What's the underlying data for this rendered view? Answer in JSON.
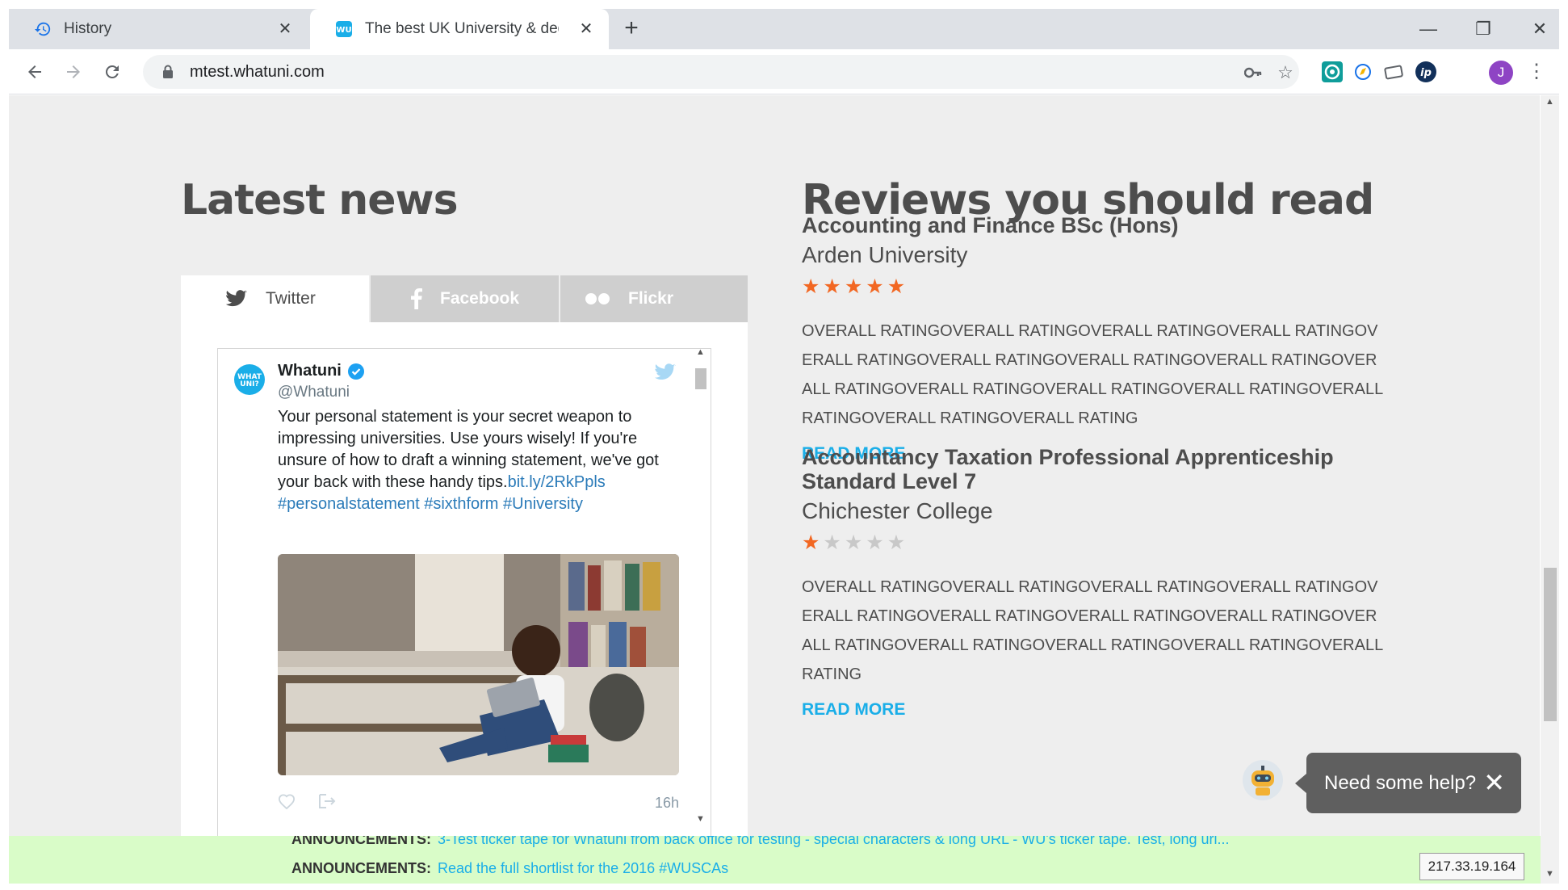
{
  "browser": {
    "tabs": [
      {
        "label": "History",
        "icon": "history-icon",
        "close": "✕"
      },
      {
        "label": "The best UK University & degree",
        "icon": "whatuni-favicon",
        "close": "✕"
      }
    ],
    "new_tab": "+",
    "url": "mtest.whatuni.com",
    "window_controls": {
      "minimize": "—",
      "restore": "❐",
      "close": "✕"
    },
    "profile_initial": "J"
  },
  "latest_news": {
    "heading": "Latest news",
    "tabs": [
      {
        "label": "Twitter",
        "icon": "twitter-icon"
      },
      {
        "label": "Facebook",
        "icon": "facebook-icon"
      },
      {
        "label": "Flickr",
        "icon": "flickr-icon"
      }
    ],
    "tweet": {
      "name": "Whatuni",
      "handle": "@Whatuni",
      "text": "Your personal statement is your secret weapon to impressing universities. Use yours wisely! If you're unsure of how to draft a winning statement, we've got your back with these handy tips.",
      "link": "bit.ly/2RkPpls",
      "hashtags": "#personalstatement #sixthform #University",
      "time": "16h"
    }
  },
  "reviews": {
    "heading": "Reviews you should read",
    "items": [
      {
        "course": "Accounting and Finance BSc (Hons)",
        "university": "Arden University",
        "rating": 5,
        "description": "OVERALL RATINGOVERALL RATINGOVERALL RATINGOVERALL RATINGOVERALL RATINGOVERALL RATINGOVERALL RATINGOVERALL RATINGOVERALL RATINGOVERALL RATINGOVERALL RATINGOVERALL RATINGOVERALL RATINGOVERALL RATINGOVERALL RATING",
        "read_more": "READ MORE"
      },
      {
        "course": "Accountancy Taxation Professional Apprenticeship Standard Level 7",
        "university": "Chichester College",
        "rating": 1,
        "description": "OVERALL RATINGOVERALL RATINGOVERALL RATINGOVERALL RATINGOVERALL RATINGOVERALL RATINGOVERALL RATINGOVERALL RATINGOVERALL RATINGOVERALL RATINGOVERALL RATINGOVERALL RATINGOVERALL RATING",
        "read_more": "READ MORE"
      }
    ]
  },
  "ticker": [
    {
      "label": "ANNOUNCEMENTS:",
      "text": "3-Test ticker tape for Whatuni from back office for testing - special characters & long URL - WU's ticker tape. Test, long url..."
    },
    {
      "label": "ANNOUNCEMENTS:",
      "text": "Read the full shortlist for the 2016 #WUSCAs"
    }
  ],
  "ip_address": "217.33.19.164",
  "help": {
    "label": "Need some help?",
    "close": "✕"
  },
  "colors": {
    "accent": "#1aaee8",
    "star": "#f26722",
    "star_empty": "#c8c8c8",
    "ticker_bg": "#d9fcc8"
  }
}
